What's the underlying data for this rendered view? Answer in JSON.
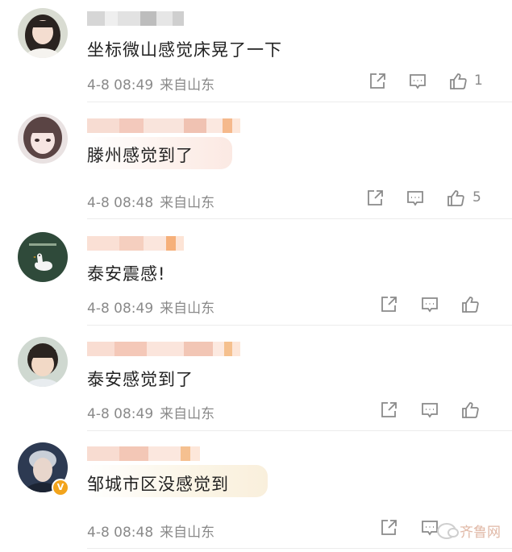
{
  "comments": [
    {
      "text": "坐标微山感觉床晃了一下",
      "time": "4-8 08:49",
      "source": "来自山东",
      "likes": "1",
      "avatar_icon": "girl-portrait-avatar"
    },
    {
      "text": "滕州感觉到了",
      "time": "4-8 08:48",
      "source": "来自山东",
      "likes": "5",
      "avatar_icon": "girl-selfie-avatar"
    },
    {
      "text": "泰安震感!",
      "time": "4-8 08:49",
      "source": "来自山东",
      "likes": "",
      "avatar_icon": "white-goose-on-green-avatar"
    },
    {
      "text": "泰安感觉到了",
      "time": "4-8 08:49",
      "source": "来自山东",
      "likes": "",
      "avatar_icon": "boy-portrait-avatar"
    },
    {
      "text": "邹城市区没感觉到",
      "time": "4-8 08:48",
      "source": "来自山东",
      "likes": "",
      "avatar_icon": "man-dark-background-avatar",
      "verified_badge": "V"
    }
  ],
  "icons": {
    "share": "share-icon",
    "comment": "comment-icon",
    "like": "thumbs-up-icon"
  },
  "watermark": {
    "text": "齐鲁网",
    "icon": "wechat-logo-icon"
  },
  "colors": {
    "meta_gray": "#8a8a8a",
    "text": "#222222",
    "badge": "#f2a41c",
    "bubble": "#fbe9e3"
  }
}
